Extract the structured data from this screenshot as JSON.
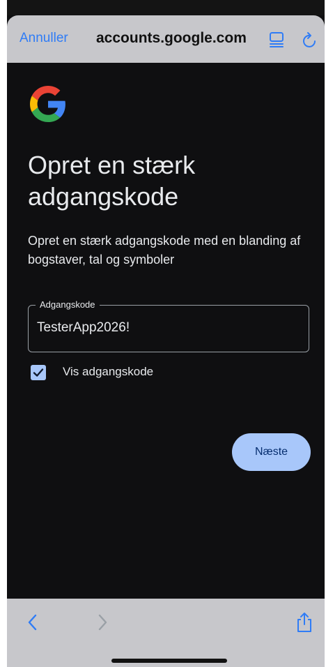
{
  "header": {
    "cancel_label": "Annuller",
    "url": "accounts.google.com"
  },
  "content": {
    "title": "Opret en stærk adgangskode",
    "subtitle": "Opret en stærk adgangskode med en blanding af bogstaver, tal og symboler",
    "password_field": {
      "label": "Adgangskode",
      "value": "TesterApp2026!"
    },
    "show_password": {
      "label": "Vis adgangskode",
      "checked": true
    },
    "next_button": "Næste"
  },
  "toolbar": {
    "icons": [
      "back-icon",
      "forward-icon",
      "share-icon"
    ]
  },
  "colors": {
    "accent": "#2f7cf6",
    "button_bg": "#a8c7fa",
    "page_bg": "#0f0f11",
    "chrome_bg": "#c7c7cb"
  }
}
